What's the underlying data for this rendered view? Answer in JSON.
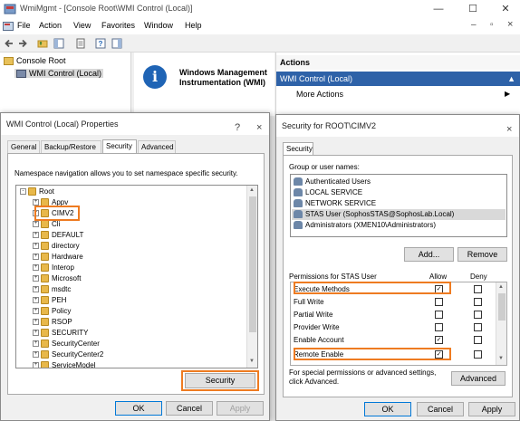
{
  "window": {
    "title": "WmiMgmt - [Console Root\\WMI Control (Local)]",
    "min_glyph": "—",
    "max_glyph": "☐",
    "close_glyph": "✕",
    "inner_controls": "–  &#9633;  ×"
  },
  "menu": [
    "File",
    "Action",
    "View",
    "Favorites",
    "Window",
    "Help"
  ],
  "inner_ctrl_min": "–",
  "inner_ctrl_max": "▫",
  "inner_ctrl_close": "×",
  "tree": {
    "root": "Console Root",
    "child": "WMI Control (Local)"
  },
  "center": {
    "info_glyph": "i",
    "heading": "Windows Management Instrumentation (WMI)"
  },
  "actions": {
    "header": "Actions",
    "selected": "WMI Control (Local)",
    "selected_arrow": "▲",
    "more": "More Actions",
    "more_arrow": "▶"
  },
  "props_dialog": {
    "title": "WMI Control (Local) Properties",
    "help_glyph": "?",
    "close_glyph": "×",
    "tabs": [
      "General",
      "Backup/Restore",
      "Security",
      "Advanced"
    ],
    "active_tab": "Security",
    "description": "Namespace navigation allows you to set namespace specific security.",
    "namespaces": [
      "Root",
      "Appv",
      "CIMV2",
      "Cli",
      "DEFAULT",
      "directory",
      "Hardware",
      "Interop",
      "Microsoft",
      "msdtc",
      "PEH",
      "Policy",
      "RSOP",
      "SECURITY",
      "SecurityCenter",
      "SecurityCenter2",
      "ServiceModel"
    ],
    "highlighted_namespace": "CIMV2",
    "security_button": "Security",
    "ok": "OK",
    "cancel": "Cancel",
    "apply": "Apply"
  },
  "sec_dialog": {
    "title": "Security for ROOT\\CIMV2",
    "close_glyph": "×",
    "tab": "Security",
    "group_label": "Group or user names:",
    "users": [
      "Authenticated Users",
      "LOCAL SERVICE",
      "NETWORK SERVICE",
      "STAS User (SophosSTAS@SophosLab.Local)",
      "Administrators (XMEN10\\Administrators)"
    ],
    "selected_user_index": 3,
    "add": "Add...",
    "remove": "Remove",
    "perm_label": "Permissions for STAS User",
    "allow": "Allow",
    "deny": "Deny",
    "permissions": [
      {
        "name": "Execute Methods",
        "allow": true,
        "deny": false
      },
      {
        "name": "Full Write",
        "allow": false,
        "deny": false
      },
      {
        "name": "Partial Write",
        "allow": false,
        "deny": false
      },
      {
        "name": "Provider Write",
        "allow": false,
        "deny": false
      },
      {
        "name": "Enable Account",
        "allow": true,
        "deny": false
      },
      {
        "name": "Remote Enable",
        "allow": true,
        "deny": false
      }
    ],
    "check_glyph": "✓",
    "special_text": "For special permissions or advanced settings, click Advanced.",
    "advanced": "Advanced",
    "ok": "OK",
    "cancel": "Cancel",
    "apply": "Apply"
  },
  "colors": {
    "highlight": "#ee7b21",
    "selection": "#2e62a8",
    "info_icon": "#1f64b5"
  }
}
